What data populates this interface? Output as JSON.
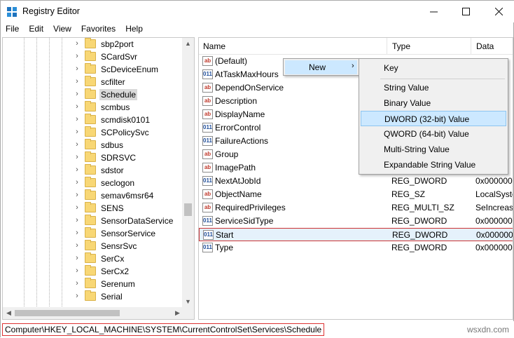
{
  "window": {
    "title": "Registry Editor"
  },
  "menubar": [
    "File",
    "Edit",
    "View",
    "Favorites",
    "Help"
  ],
  "tree": {
    "items": [
      {
        "label": "sbp2port",
        "selected": false
      },
      {
        "label": "SCardSvr",
        "selected": false
      },
      {
        "label": "ScDeviceEnum",
        "selected": false
      },
      {
        "label": "scfilter",
        "selected": false
      },
      {
        "label": "Schedule",
        "selected": true
      },
      {
        "label": "scmbus",
        "selected": false
      },
      {
        "label": "scmdisk0101",
        "selected": false
      },
      {
        "label": "SCPolicySvc",
        "selected": false
      },
      {
        "label": "sdbus",
        "selected": false
      },
      {
        "label": "SDRSVC",
        "selected": false
      },
      {
        "label": "sdstor",
        "selected": false
      },
      {
        "label": "seclogon",
        "selected": false
      },
      {
        "label": "semav6msr64",
        "selected": false
      },
      {
        "label": "SENS",
        "selected": false
      },
      {
        "label": "SensorDataService",
        "selected": false
      },
      {
        "label": "SensorService",
        "selected": false
      },
      {
        "label": "SensrSvc",
        "selected": false
      },
      {
        "label": "SerCx",
        "selected": false
      },
      {
        "label": "SerCx2",
        "selected": false
      },
      {
        "label": "Serenum",
        "selected": false
      },
      {
        "label": "Serial",
        "selected": false
      }
    ]
  },
  "list": {
    "columns": {
      "name": "Name",
      "type": "Type",
      "data": "Data"
    },
    "rows": [
      {
        "name": "(Default)",
        "type": "",
        "data": "",
        "icon": "string-value-icon"
      },
      {
        "name": "AtTaskMaxHours",
        "type": "",
        "data": "",
        "icon": "binary-value-icon"
      },
      {
        "name": "DependOnService",
        "type": "",
        "data": "",
        "icon": "string-value-icon"
      },
      {
        "name": "Description",
        "type": "",
        "data": "",
        "icon": "string-value-icon"
      },
      {
        "name": "DisplayName",
        "type": "",
        "data": "",
        "icon": "string-value-icon"
      },
      {
        "name": "ErrorControl",
        "type": "",
        "data": "",
        "icon": "binary-value-icon"
      },
      {
        "name": "FailureActions",
        "type": "",
        "data": "",
        "icon": "binary-value-icon"
      },
      {
        "name": "Group",
        "type": "",
        "data": "",
        "icon": "string-value-icon"
      },
      {
        "name": "ImagePath",
        "type": "",
        "data": "",
        "icon": "string-value-icon"
      },
      {
        "name": "NextAtJobId",
        "type": "REG_DWORD",
        "data": "0x0000000",
        "icon": "binary-value-icon"
      },
      {
        "name": "ObjectName",
        "type": "REG_SZ",
        "data": "LocalSyste",
        "icon": "string-value-icon"
      },
      {
        "name": "RequiredPrivileges",
        "type": "REG_MULTI_SZ",
        "data": "SeIncrease",
        "icon": "string-value-icon"
      },
      {
        "name": "ServiceSidType",
        "type": "REG_DWORD",
        "data": "0x0000000",
        "icon": "binary-value-icon"
      },
      {
        "name": "Start",
        "type": "REG_DWORD",
        "data": "0x0000000",
        "icon": "binary-value-icon",
        "selected": true
      },
      {
        "name": "Type",
        "type": "REG_DWORD",
        "data": "0x0000002",
        "icon": "binary-value-icon"
      }
    ]
  },
  "context_menu": {
    "parent_item": "New",
    "submenu": [
      "Key",
      "String Value",
      "Binary Value",
      "DWORD (32-bit) Value",
      "QWORD (64-bit) Value",
      "Multi-String Value",
      "Expandable String Value"
    ],
    "highlighted": "DWORD (32-bit) Value"
  },
  "statusbar": {
    "path": "Computer\\HKEY_LOCAL_MACHINE\\SYSTEM\\CurrentControlSet\\Services\\Schedule"
  },
  "watermark": "wsxdn.com",
  "colors": {
    "highlight": "#cce8ff",
    "selection_border": "#cc3333",
    "folder": "#f8d775"
  }
}
